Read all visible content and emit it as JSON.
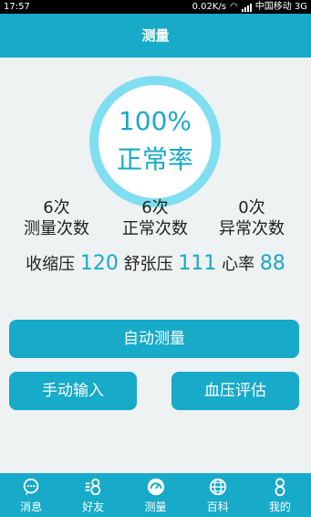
{
  "status_bar": {
    "time": "17:57",
    "speed": "0.02K/s",
    "carrier": "中国移动 3G"
  },
  "header": {
    "title": "测量"
  },
  "summary": {
    "percent": "100%",
    "status": "正常率"
  },
  "stats": [
    {
      "count": "6次",
      "label": "测量次数"
    },
    {
      "count": "6次",
      "label": "正常次数"
    },
    {
      "count": "0次",
      "label": "异常次数"
    }
  ],
  "blood_pressure": {
    "systolic_label": "收缩压",
    "systolic_value": "120",
    "diastolic_label": "舒张压",
    "diastolic_value": "111",
    "heart_rate_label": "心率",
    "heart_rate_value": "88"
  },
  "buttons": {
    "auto": "自动测量",
    "manual": "手动输入",
    "assess": "血压评估"
  },
  "tabs": [
    {
      "label": "消息",
      "icon": "chat-icon"
    },
    {
      "label": "好友",
      "icon": "friends-icon"
    },
    {
      "label": "测量",
      "icon": "gauge-icon"
    },
    {
      "label": "百科",
      "icon": "globe-icon"
    },
    {
      "label": "我的",
      "icon": "person-icon"
    }
  ],
  "colors": {
    "accent": "#17aac9",
    "ring": "#7fdff0",
    "background": "#eef2f2"
  }
}
